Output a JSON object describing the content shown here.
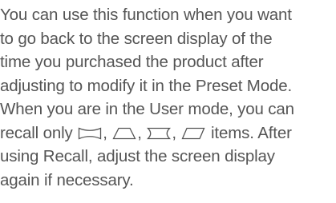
{
  "document": {
    "text_color": "#555555",
    "lines": {
      "l1": "You can use this function when you want",
      "l2": "to go back to the screen display of the",
      "l3": "time you purchased the product after",
      "l4": "adjusting to modify it in the Preset Mode.",
      "l5": "When you are in the User mode, you can",
      "l6_before": "recall only",
      "sep": ",",
      "l6_after": "items. After",
      "l7": "using Recall, adjust the screen display",
      "l8": "again if necessary."
    },
    "recall_icons": [
      "pincushion-icon",
      "trapezoid-icon",
      "side-pincushion-icon",
      "parallelogram-icon"
    ]
  }
}
